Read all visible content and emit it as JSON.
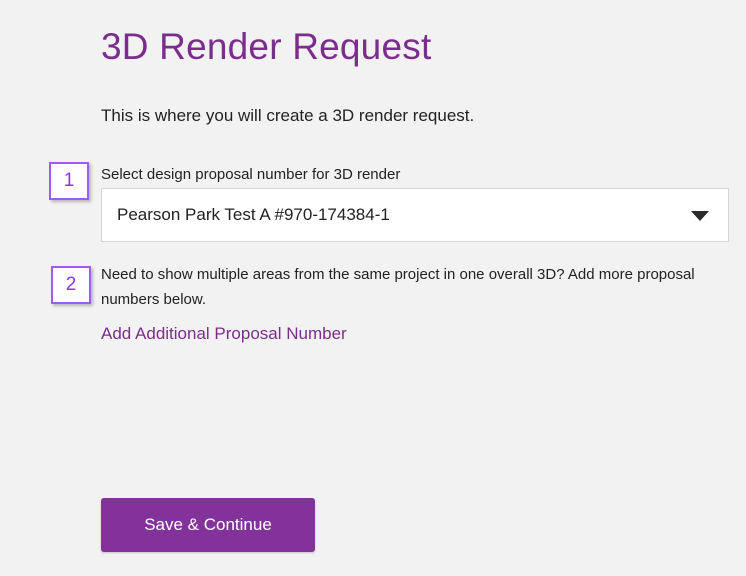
{
  "page": {
    "title": "3D Render Request",
    "intro": "This is where you will create a 3D render request."
  },
  "steps": [
    {
      "number": "1"
    },
    {
      "number": "2"
    }
  ],
  "proposal_select": {
    "label": "Select design proposal number for 3D render",
    "selected_value": "Pearson Park Test A #970-174384-1",
    "icon": "caret-down-icon"
  },
  "additional": {
    "note": "Need to show multiple areas from the same project in one overall 3D? Add more proposal numbers below.",
    "add_link_label": "Add Additional Proposal Number"
  },
  "actions": {
    "save_label": "Save & Continue"
  },
  "colors": {
    "brand_purple": "#84329b",
    "title_purple": "#7b2d8e",
    "badge_border": "#a05cf0",
    "background": "#f2f2f2"
  }
}
